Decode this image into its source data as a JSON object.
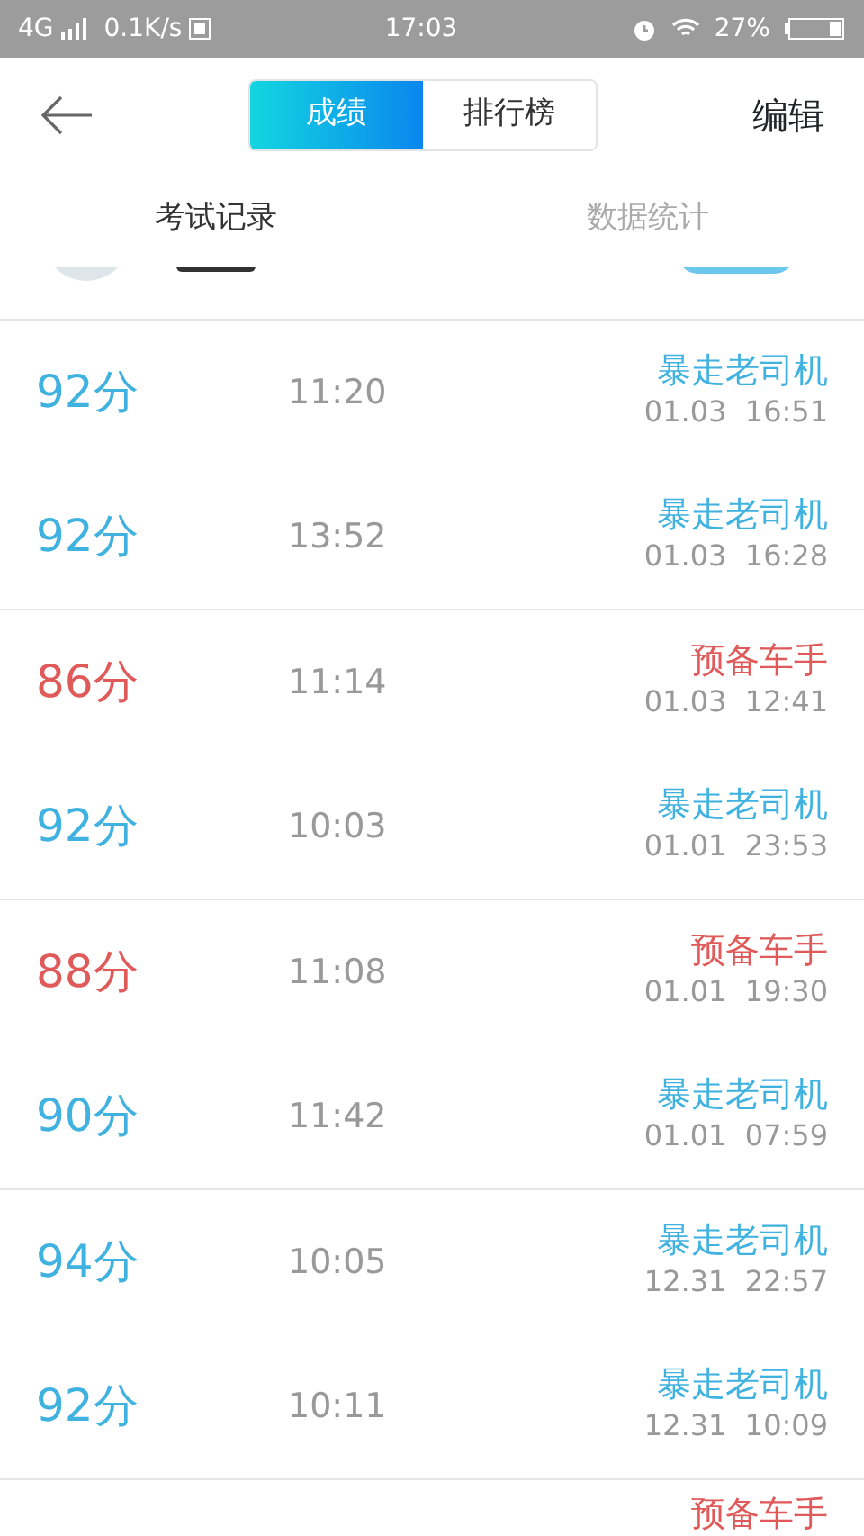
{
  "status_bar": {
    "network": "4G",
    "speed": "0.1K/s",
    "time": "17:03",
    "battery_text": "27%"
  },
  "header": {
    "segments": [
      {
        "label": "成绩",
        "selected": true
      },
      {
        "label": "排行榜",
        "selected": false
      }
    ],
    "action": "编辑"
  },
  "tabs": [
    {
      "label": "考试记录",
      "selected": true
    },
    {
      "label": "数据统计",
      "selected": false
    }
  ],
  "groups": [
    {
      "rows": [
        {
          "score": "92分",
          "duration": "11:20",
          "rank": "暴走老司机",
          "date": "01.03  16:51",
          "color": "#3fb2e0"
        },
        {
          "score": "92分",
          "duration": "13:52",
          "rank": "暴走老司机",
          "date": "01.03  16:28",
          "color": "#3fb2e0"
        }
      ]
    },
    {
      "rows": [
        {
          "score": "86分",
          "duration": "11:14",
          "rank": "预备车手",
          "date": "01.03  12:41",
          "color": "#e05a5a"
        },
        {
          "score": "92分",
          "duration": "10:03",
          "rank": "暴走老司机",
          "date": "01.01  23:53",
          "color": "#3fb2e0"
        }
      ]
    },
    {
      "rows": [
        {
          "score": "88分",
          "duration": "11:08",
          "rank": "预备车手",
          "date": "01.01  19:30",
          "color": "#e05a5a"
        },
        {
          "score": "90分",
          "duration": "11:42",
          "rank": "暴走老司机",
          "date": "01.01  07:59",
          "color": "#3fb2e0"
        }
      ]
    },
    {
      "rows": [
        {
          "score": "94分",
          "duration": "10:05",
          "rank": "暴走老司机",
          "date": "12.31  22:57",
          "color": "#3fb2e0"
        },
        {
          "score": "92分",
          "duration": "10:11",
          "rank": "暴走老司机",
          "date": "12.31  10:09",
          "color": "#3fb2e0"
        }
      ]
    },
    {
      "rows": [
        {
          "rank": "预备车手",
          "color": "#e05a5a"
        }
      ]
    }
  ]
}
